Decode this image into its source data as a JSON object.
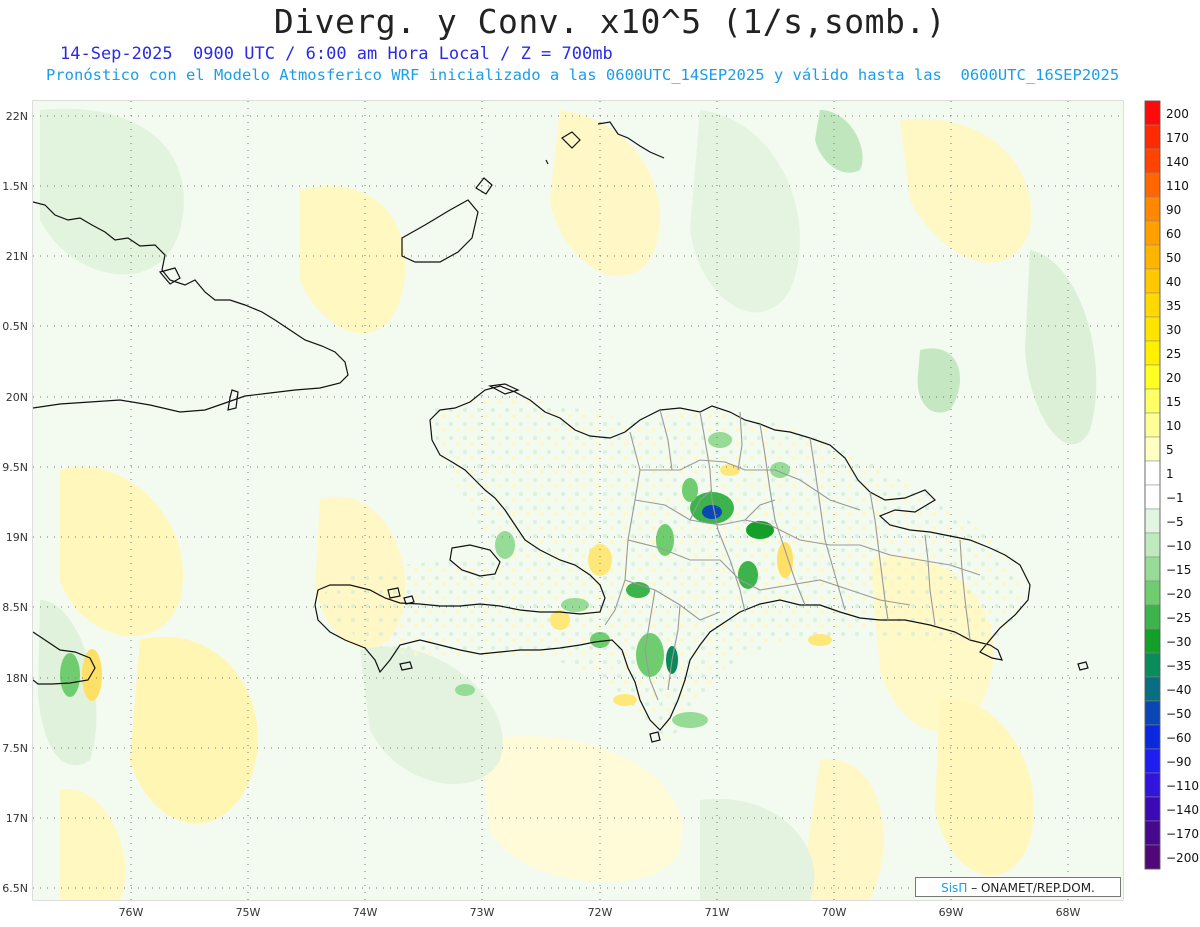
{
  "header": {
    "title": "Diverg. y Conv. x10^5 (1/s,somb.)",
    "subtitle_line1": "14-Sep-2025  0900 UTC / 6:00 am Hora Local / Z = 700mb",
    "subtitle_line2": "Pronóstico con el Modelo Atmosferico WRF inicializado a las 0600UTC_14SEP2025 y válido hasta las  0600UTC_16SEP2025"
  },
  "axes": {
    "lat_labels": [
      "22N",
      "1.5N",
      "21N",
      "0.5N",
      "20N",
      "9.5N",
      "19N",
      "8.5N",
      "18N",
      "7.5N",
      "17N",
      "6.5N"
    ],
    "lon_labels": [
      "76W",
      "75W",
      "74W",
      "73W",
      "72W",
      "71W",
      "70W",
      "69W",
      "68W"
    ]
  },
  "colorbar": {
    "labels": [
      "200",
      "170",
      "140",
      "110",
      "90",
      "60",
      "50",
      "40",
      "35",
      "30",
      "25",
      "20",
      "15",
      "10",
      "5",
      "1",
      "−1",
      "−5",
      "−10",
      "−15",
      "−20",
      "−25",
      "−30",
      "−35",
      "−40",
      "−50",
      "−60",
      "−90",
      "−110",
      "−140",
      "−170",
      "−200"
    ],
    "colors": [
      "#ff0a0a",
      "#ff2a00",
      "#ff4400",
      "#ff6600",
      "#ff8800",
      "#ffa000",
      "#ffb400",
      "#ffc800",
      "#ffd800",
      "#ffe400",
      "#fff000",
      "#ffff22",
      "#ffff66",
      "#ffff99",
      "#ffffc4",
      "#ffffff",
      "#ffffff",
      "#e2f5e2",
      "#bfeabf",
      "#96db96",
      "#6fcd6f",
      "#3cb44b",
      "#14a028",
      "#0a8c5a",
      "#0a6e82",
      "#0a46b4",
      "#0a28dc",
      "#1e1ef0",
      "#3214dc",
      "#3c0ab4",
      "#46088c",
      "#500878"
    ]
  },
  "credit": {
    "brand": "SisΠ",
    "text": " – ONAMET/REP.DOM."
  }
}
